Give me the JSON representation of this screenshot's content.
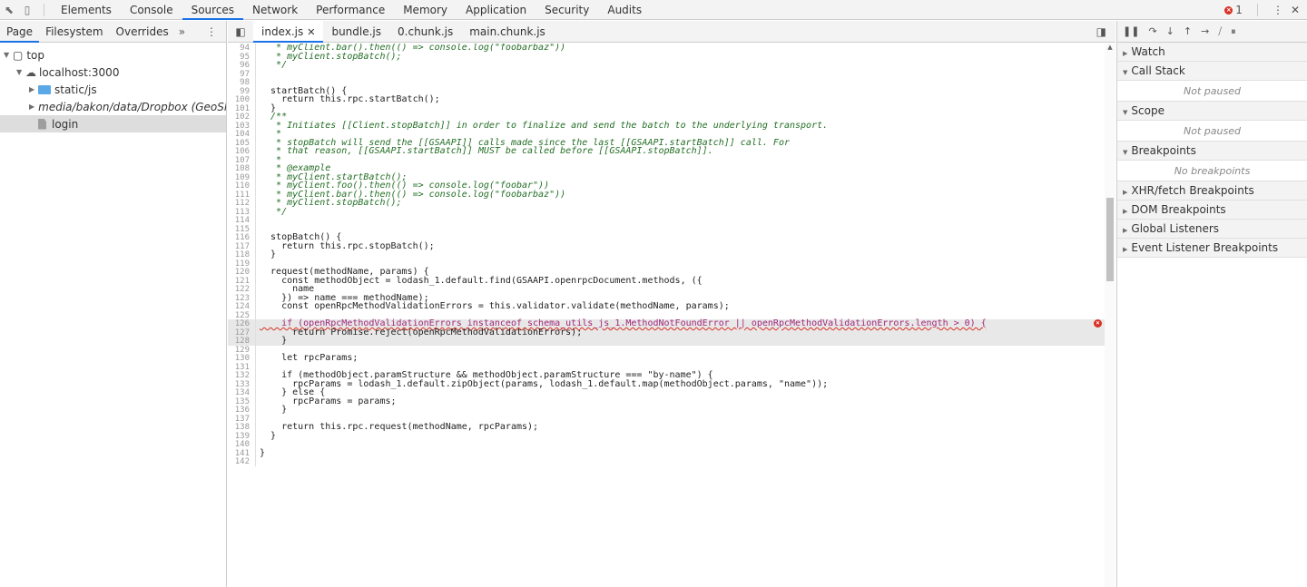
{
  "toolbar": {
    "tabs": [
      "Elements",
      "Console",
      "Sources",
      "Network",
      "Performance",
      "Memory",
      "Application",
      "Security",
      "Audits"
    ],
    "active_tab": "Sources",
    "error_count": "1"
  },
  "navigator": {
    "tabs": [
      "Page",
      "Filesystem",
      "Overrides"
    ],
    "more": "»",
    "tree": [
      {
        "label": "top",
        "indent": 0,
        "kind": "frame",
        "expanded": true
      },
      {
        "label": "localhost:3000",
        "indent": 1,
        "kind": "cloud",
        "expanded": true
      },
      {
        "label": "static/js",
        "indent": 2,
        "kind": "folder-blue",
        "expanded": false
      },
      {
        "label": "media/bakon/data/Dropbox (GeoSkyGl",
        "indent": 2,
        "kind": "folder-orange",
        "expanded": false
      },
      {
        "label": "login",
        "indent": 2,
        "kind": "file",
        "expanded": false
      }
    ]
  },
  "editor": {
    "tabs": [
      "index.js",
      "bundle.js",
      "0.chunk.js",
      "main.chunk.js"
    ],
    "active_tab": "index.js",
    "lines": [
      {
        "n": "94",
        "t": "   * myClient.bar().then(() => console.log(\"foobarbaz\"))",
        "c": "cm"
      },
      {
        "n": "95",
        "t": "   * myClient.stopBatch();",
        "c": "cm"
      },
      {
        "n": "96",
        "t": "   */",
        "c": "cm"
      },
      {
        "n": "97",
        "t": "",
        "c": ""
      },
      {
        "n": "98",
        "t": "",
        "c": ""
      },
      {
        "n": "99",
        "t": "  startBatch() {",
        "c": ""
      },
      {
        "n": "100",
        "t": "    return this.rpc.startBatch();",
        "c": ""
      },
      {
        "n": "101",
        "t": "  }",
        "c": ""
      },
      {
        "n": "102",
        "t": "  /**",
        "c": "cm"
      },
      {
        "n": "103",
        "t": "   * Initiates [[Client.stopBatch]] in order to finalize and send the batch to the underlying transport.",
        "c": "cm"
      },
      {
        "n": "104",
        "t": "   *",
        "c": "cm"
      },
      {
        "n": "105",
        "t": "   * stopBatch will send the [[GSAAPI]] calls made since the last [[GSAAPI.startBatch]] call. For",
        "c": "cm"
      },
      {
        "n": "106",
        "t": "   * that reason, [[GSAAPI.startBatch]] MUST be called before [[GSAAPI.stopBatch]].",
        "c": "cm"
      },
      {
        "n": "107",
        "t": "   *",
        "c": "cm"
      },
      {
        "n": "108",
        "t": "   * @example",
        "c": "cm"
      },
      {
        "n": "109",
        "t": "   * myClient.startBatch();",
        "c": "cm"
      },
      {
        "n": "110",
        "t": "   * myClient.foo().then(() => console.log(\"foobar\"))",
        "c": "cm"
      },
      {
        "n": "111",
        "t": "   * myClient.bar().then(() => console.log(\"foobarbaz\"))",
        "c": "cm"
      },
      {
        "n": "112",
        "t": "   * myClient.stopBatch();",
        "c": "cm"
      },
      {
        "n": "113",
        "t": "   */",
        "c": "cm"
      },
      {
        "n": "114",
        "t": "",
        "c": ""
      },
      {
        "n": "115",
        "t": "",
        "c": ""
      },
      {
        "n": "116",
        "t": "  stopBatch() {",
        "c": ""
      },
      {
        "n": "117",
        "t": "    return this.rpc.stopBatch();",
        "c": ""
      },
      {
        "n": "118",
        "t": "  }",
        "c": ""
      },
      {
        "n": "119",
        "t": "",
        "c": ""
      },
      {
        "n": "120",
        "t": "  request(methodName, params) {",
        "c": ""
      },
      {
        "n": "121",
        "t": "    const methodObject = lodash_1.default.find(GSAAPI.openrpcDocument.methods, ({",
        "c": ""
      },
      {
        "n": "122",
        "t": "      name",
        "c": ""
      },
      {
        "n": "123",
        "t": "    }) => name === methodName);",
        "c": ""
      },
      {
        "n": "124",
        "t": "    const openRpcMethodValidationErrors = this.validator.validate(methodName, params);",
        "c": ""
      },
      {
        "n": "125",
        "t": "",
        "c": ""
      },
      {
        "n": "126",
        "t": "    if (openRpcMethodValidationErrors instanceof schema_utils_js_1.MethodNotFoundError || openRpcMethodValidationErrors.length > 0) {",
        "c": "err"
      },
      {
        "n": "127",
        "t": "      return Promise.reject(openRpcMethodValidationErrors);",
        "c": "hl"
      },
      {
        "n": "128",
        "t": "    }",
        "c": "hl"
      },
      {
        "n": "129",
        "t": "",
        "c": ""
      },
      {
        "n": "130",
        "t": "    let rpcParams;",
        "c": ""
      },
      {
        "n": "131",
        "t": "",
        "c": ""
      },
      {
        "n": "132",
        "t": "    if (methodObject.paramStructure && methodObject.paramStructure === \"by-name\") {",
        "c": ""
      },
      {
        "n": "133",
        "t": "      rpcParams = lodash_1.default.zipObject(params, lodash_1.default.map(methodObject.params, \"name\"));",
        "c": ""
      },
      {
        "n": "134",
        "t": "    } else {",
        "c": ""
      },
      {
        "n": "135",
        "t": "      rpcParams = params;",
        "c": ""
      },
      {
        "n": "136",
        "t": "    }",
        "c": ""
      },
      {
        "n": "137",
        "t": "",
        "c": ""
      },
      {
        "n": "138",
        "t": "    return this.rpc.request(methodName, rpcParams);",
        "c": ""
      },
      {
        "n": "139",
        "t": "  }",
        "c": ""
      },
      {
        "n": "140",
        "t": "",
        "c": ""
      },
      {
        "n": "141",
        "t": "}",
        "c": ""
      },
      {
        "n": "142",
        "t": "",
        "c": ""
      }
    ]
  },
  "debugger": {
    "sections": [
      {
        "label": "Watch",
        "expanded": false,
        "body": ""
      },
      {
        "label": "Call Stack",
        "expanded": true,
        "body": "Not paused"
      },
      {
        "label": "Scope",
        "expanded": true,
        "body": "Not paused"
      },
      {
        "label": "Breakpoints",
        "expanded": true,
        "body": "No breakpoints"
      },
      {
        "label": "XHR/fetch Breakpoints",
        "expanded": false,
        "body": ""
      },
      {
        "label": "DOM Breakpoints",
        "expanded": false,
        "body": ""
      },
      {
        "label": "Global Listeners",
        "expanded": false,
        "body": ""
      },
      {
        "label": "Event Listener Breakpoints",
        "expanded": false,
        "body": ""
      }
    ]
  },
  "colors": {
    "accent": "#1a73e8",
    "error": "#d93025",
    "comment": "#236e25"
  }
}
